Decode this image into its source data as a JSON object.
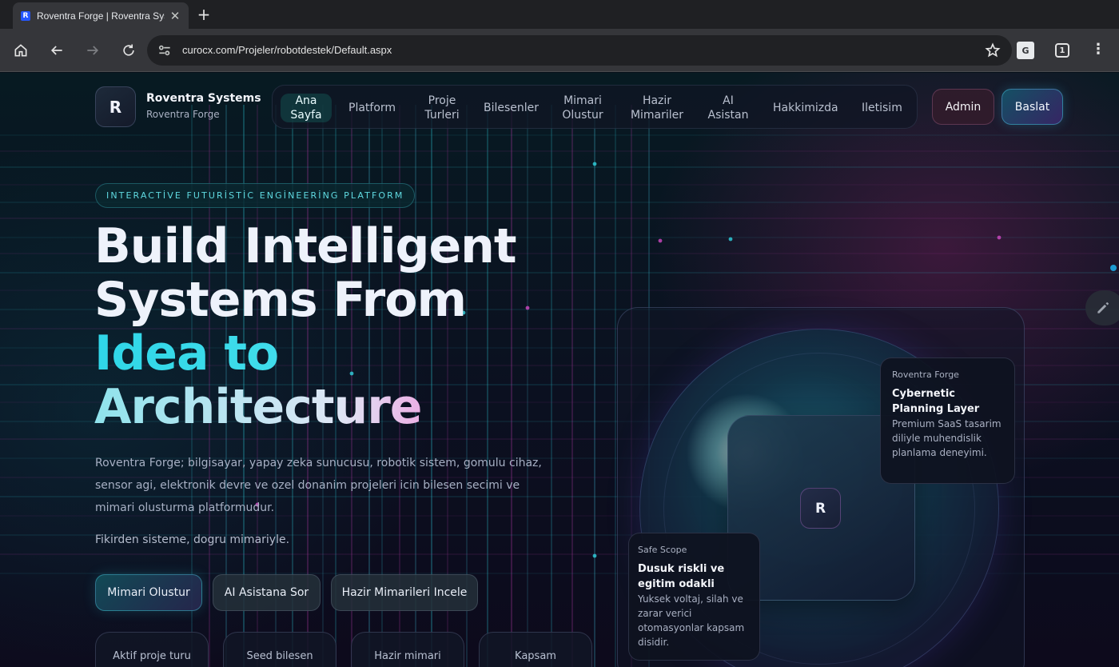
{
  "browser": {
    "tab_title": "Roventra Forge | Roventra Systems",
    "tab_favicon_letter": "R",
    "url": "curocx.com/Projeler/robotdestek/Default.aspx",
    "tab_count": "1",
    "icons": [
      "home-icon",
      "back-icon",
      "forward-icon",
      "reload-icon",
      "site-settings-icon",
      "bookmark-star-icon",
      "translate-icon",
      "tab-count-icon",
      "menu-icon"
    ]
  },
  "header": {
    "logo_letter": "R",
    "brand_name": "Roventra Systems",
    "brand_sub": "Roventra Forge",
    "nav": [
      {
        "label": "Ana Sayfa",
        "active": true
      },
      {
        "label": "Platform"
      },
      {
        "label": "Proje Turleri"
      },
      {
        "label": "Bilesenler"
      },
      {
        "label": "Mimari Olustur"
      },
      {
        "label": "Hazir Mimariler"
      },
      {
        "label": "AI Asistan"
      },
      {
        "label": "Hakkimizda"
      },
      {
        "label": "Iletisim"
      }
    ],
    "admin_label": "Admin",
    "start_label": "Baslat"
  },
  "hero": {
    "kicker": "INTERACTİVE FUTURİSTİC ENGİNEERİNG PLATFORM",
    "title_line1": "Build Intelligent",
    "title_line2": "Systems From",
    "title_line3": "Idea to",
    "title_line4": "Architecture",
    "description": "Roventra Forge; bilgisayar, yapay zeka sunucusu, robotik sistem, gomulu cihaz, sensor agi, elektronik devre ve ozel donanim projeleri icin bilesen secimi ve mimari olusturma platformudur.",
    "tagline": "Fikirden sisteme, dogru mimariyle.",
    "cta_primary": "Mimari Olustur",
    "cta_secondary": "AI Asistana Sor",
    "cta_tertiary": "Hazir Mimarileri Incele",
    "stats": [
      "Aktif proje turu",
      "Seed bilesen",
      "Hazir mimari",
      "Kapsam"
    ]
  },
  "visual": {
    "core_letter": "R",
    "planning_card": {
      "kicker": "Roventra Forge",
      "title": "Cybernetic Planning Layer",
      "body": "Premium SaaS tasarim diliyle muhendislik planlama deneyimi."
    },
    "scope_card": {
      "kicker": "Safe Scope",
      "title": "Dusuk riskli ve egitim odakli",
      "body": "Yuksek voltaj, silah ve zarar verici otomasyonlar kapsam disidir."
    }
  },
  "colors": {
    "accent_cyan": "#2fd6e8",
    "accent_magenta": "#e64fd0",
    "background": "#07101a"
  }
}
